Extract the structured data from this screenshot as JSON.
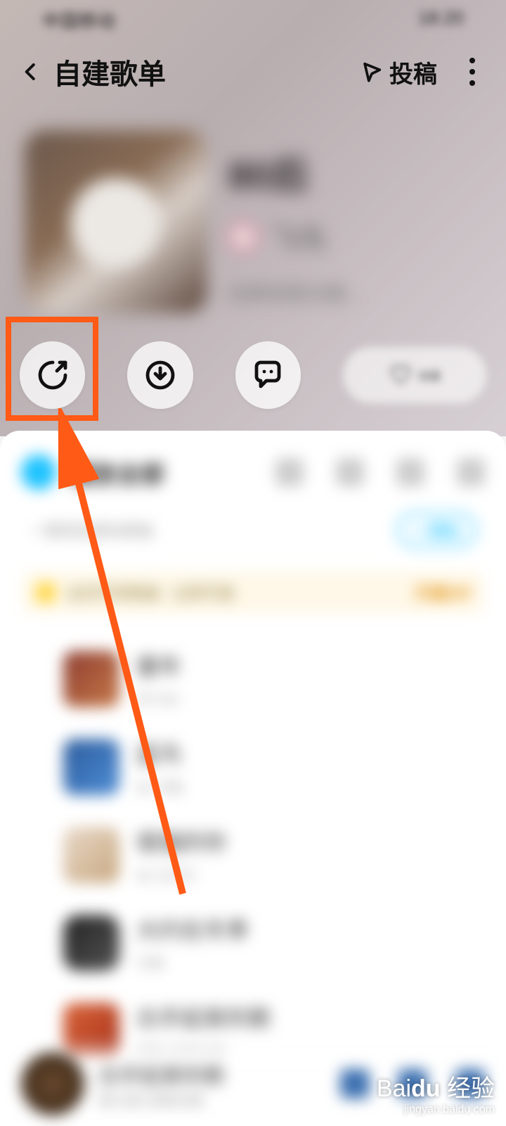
{
  "status": {
    "left": "中国移动",
    "right": "18:20"
  },
  "header": {
    "title": "自建歌单",
    "submit_label": "投稿"
  },
  "playlist": {
    "title": "80后",
    "author": "飞鸟",
    "desc": "经典老歌合集…"
  },
  "actions": {
    "like_label": "收藏"
  },
  "list_header": {
    "play_all": "播放全部"
  },
  "sub_row": {
    "hint": "一键添加相似歌曲",
    "tag": "+ 添加"
  },
  "promo": {
    "text_a": "会员专享歌曲",
    "text_b": "立即开通",
    "cta": "开通VIP"
  },
  "songs": [
    {
      "title": "童年",
      "subtitle": "罗大佑"
    },
    {
      "title": "蓝鸟",
      "subtitle": "★ 许巍"
    },
    {
      "title": "倔强的你",
      "subtitle": "★ 五月天"
    },
    {
      "title": "大约在冬季",
      "subtitle": "齐秦"
    },
    {
      "title": "白手起家的歌",
      "subtitle": "群星·经典合辑"
    }
  ],
  "mini_player": {
    "title": "白手起家的歌",
    "subtitle": "第15首·经典合辑"
  },
  "watermark": {
    "brand": "Baidu 经验",
    "url": "jingyan.baidu.com"
  }
}
